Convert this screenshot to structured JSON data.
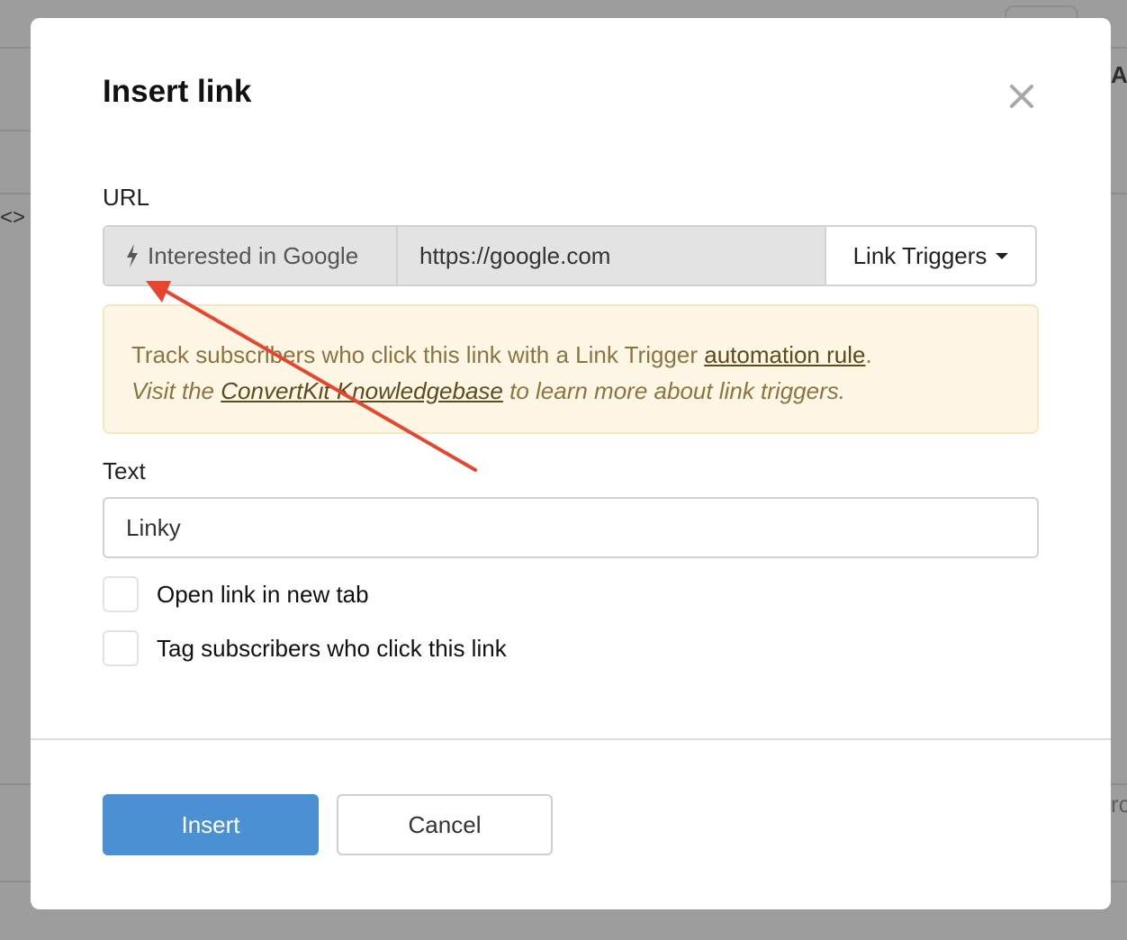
{
  "background": {
    "code_icon": "<>",
    "right_letter": "A",
    "right_partial": "rc"
  },
  "modal": {
    "title": "Insert link",
    "close_icon": "close-icon"
  },
  "url_field": {
    "label": "URL",
    "trigger_name": "Interested in Google",
    "trigger_icon": "lightning-bolt-icon",
    "value": "https://google.com",
    "dropdown_label": "Link Triggers"
  },
  "notice": {
    "line1_prefix": "Track subscribers who click this link with a Link Trigger ",
    "line1_link": "automation rule",
    "line1_suffix": ".",
    "line2_prefix": "Visit the ",
    "line2_link": "ConvertKit Knowledgebase",
    "line2_suffix": " to learn more about link triggers."
  },
  "text_field": {
    "label": "Text",
    "value": "Linky"
  },
  "options": [
    {
      "label": "Open link in new tab",
      "checked": false
    },
    {
      "label": "Tag subscribers who click this link",
      "checked": false
    }
  ],
  "buttons": {
    "insert_label": "Insert",
    "cancel_label": "Cancel"
  },
  "colors": {
    "primary": "#4a90d2",
    "notice_bg": "#fdf6e5",
    "notice_text": "#8b7440",
    "annotation_arrow": "#e8452f"
  }
}
